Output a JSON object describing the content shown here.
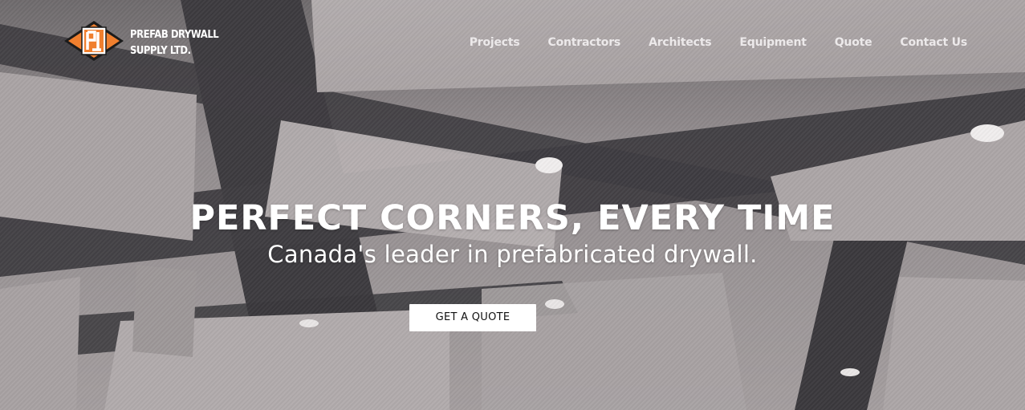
{
  "brand": {
    "name_line1": "PREFAB DRYWALL",
    "name_line2": "SUPPLY LTD.",
    "logo_icon": "pd-monogram-diamond-icon",
    "accent_color": "#f07f2e"
  },
  "nav": {
    "items": [
      {
        "label": "Projects"
      },
      {
        "label": "Contractors"
      },
      {
        "label": "Architects"
      },
      {
        "label": "Equipment"
      },
      {
        "label": "Quote"
      },
      {
        "label": "Contact Us"
      }
    ]
  },
  "hero": {
    "headline": "PERFECT CORNERS, EVERY TIME",
    "tagline": "Canada's leader in prefabricated drywall.",
    "cta_label": "GET A QUOTE",
    "background_image": "ceiling-bulkheads-photo"
  }
}
